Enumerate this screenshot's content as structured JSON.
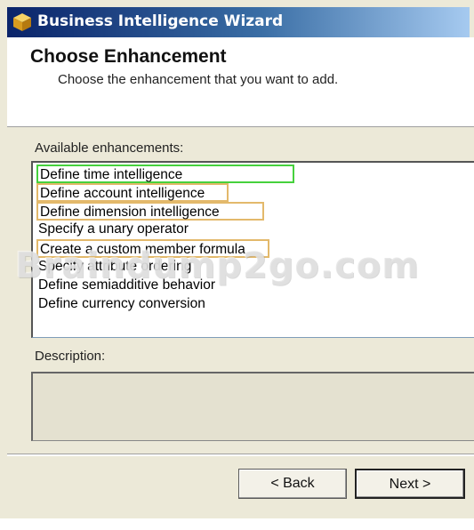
{
  "window": {
    "title": "Business Intelligence Wizard",
    "icon": "cube-icon"
  },
  "header": {
    "title": "Choose Enhancement",
    "subtitle": "Choose the enhancement that you want to add."
  },
  "enhancements": {
    "label": "Available enhancements:",
    "items": [
      "Define time intelligence",
      "Define account intelligence",
      "Define dimension intelligence",
      "Specify a unary operator",
      "Create a custom member formula",
      "Specify attribute ordering",
      "Define semiadditive behavior",
      "Define currency conversion"
    ],
    "selected": "Define time intelligence"
  },
  "description": {
    "label": "Description:",
    "text": ""
  },
  "buttons": {
    "back": "< Back",
    "next": "Next >"
  },
  "watermark": "Braindump2go.com",
  "colors": {
    "titlebar_start": "#0a246a",
    "selection_highlight": "#46d13d",
    "item_outline": "#e3b96b"
  }
}
